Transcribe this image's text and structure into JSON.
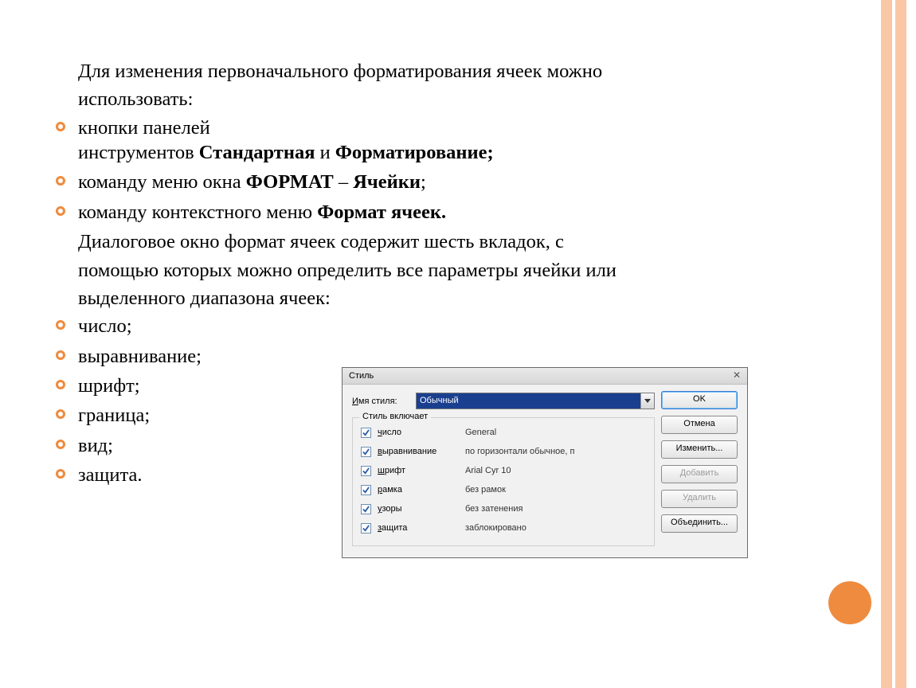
{
  "slide": {
    "intro_line1": "Для изменения первоначального форматирования ячеек можно",
    "intro_line2": "использовать:",
    "bullets_a": {
      "item1_prefix": "кнопки панелей",
      "item1_line2_prefix": "инструментов ",
      "item1_bold1": "Стандартная",
      "item1_and": " и ",
      "item1_bold2": "Форматирование;",
      "item2_prefix": "команду меню окна ",
      "item2_bold1": "ФОРМАТ",
      "item2_dash": " – ",
      "item2_bold2": "Ячейки",
      "item2_suffix": ";",
      "item3_prefix": "команду контекстного меню ",
      "item3_bold": "Формат ячеек."
    },
    "mid_line1": "Диалоговое окно формат ячеек содержит шесть вкладок, с",
    "mid_line2": "помощью которых можно определить все параметры ячейки или",
    "mid_line3": "выделенного диапазона ячеек:",
    "bullets_b": [
      "число;",
      "выравнивание;",
      "шрифт;",
      "граница;",
      "вид;",
      "защита."
    ]
  },
  "dialog": {
    "title": "Стиль",
    "close": "✕",
    "style_name_label": "Имя стиля:",
    "style_name_value": "Обычный",
    "group_legend": "Стиль включает",
    "rows": [
      {
        "label": "число",
        "value": "General"
      },
      {
        "label": "выравнивание",
        "value": "по горизонтали обычное, п"
      },
      {
        "label": "шрифт",
        "value": "Arial Cyr 10"
      },
      {
        "label": "рамка",
        "value": "без рамок"
      },
      {
        "label": "узоры",
        "value": "без затенения"
      },
      {
        "label": "защита",
        "value": "заблокировано"
      }
    ],
    "buttons": {
      "ok": "OK",
      "cancel": "Отмена",
      "modify": "Изменить...",
      "add": "Добавить",
      "delete": "Удалить",
      "merge": "Объединить..."
    }
  }
}
